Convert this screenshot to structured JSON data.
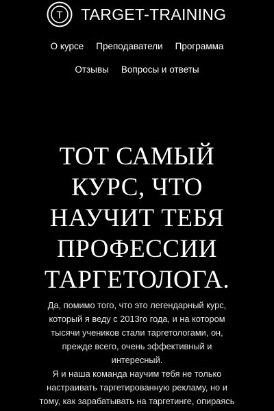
{
  "colors": {
    "background": "#000000",
    "text": "#ffffff",
    "body_text": "#e6e6e6"
  },
  "header": {
    "logo_icon": "target-circle-t-icon",
    "logo_letter": "T",
    "logo_text": "TARGET-TRAINING"
  },
  "nav": {
    "items": [
      {
        "label": "О курсе"
      },
      {
        "label": "Преподаватели"
      },
      {
        "label": "Программа"
      },
      {
        "label": "Отзывы"
      },
      {
        "label": "Вопросы и ответы"
      }
    ]
  },
  "hero": {
    "headline_lines": [
      "ТОТ САМЫЙ",
      "КУРС, ЧТО",
      "НАУЧИТ ТЕБЯ",
      "ПРОФЕССИИ",
      "ТАРГЕТОЛОГА."
    ],
    "description_lines": [
      "Да, помимо того, что это легендарный курс,",
      "который я веду с 2013го года, и на котором",
      "тысячи учеников стали таргетологами, он,",
      "прежде всего, очень эффективный и",
      "интересный.",
      "Я и наша команда научим тебя не только",
      "настраивать таргетированную рекламу, но и",
      "тому, как зарабатывать на таргетинге, опираясь"
    ]
  }
}
